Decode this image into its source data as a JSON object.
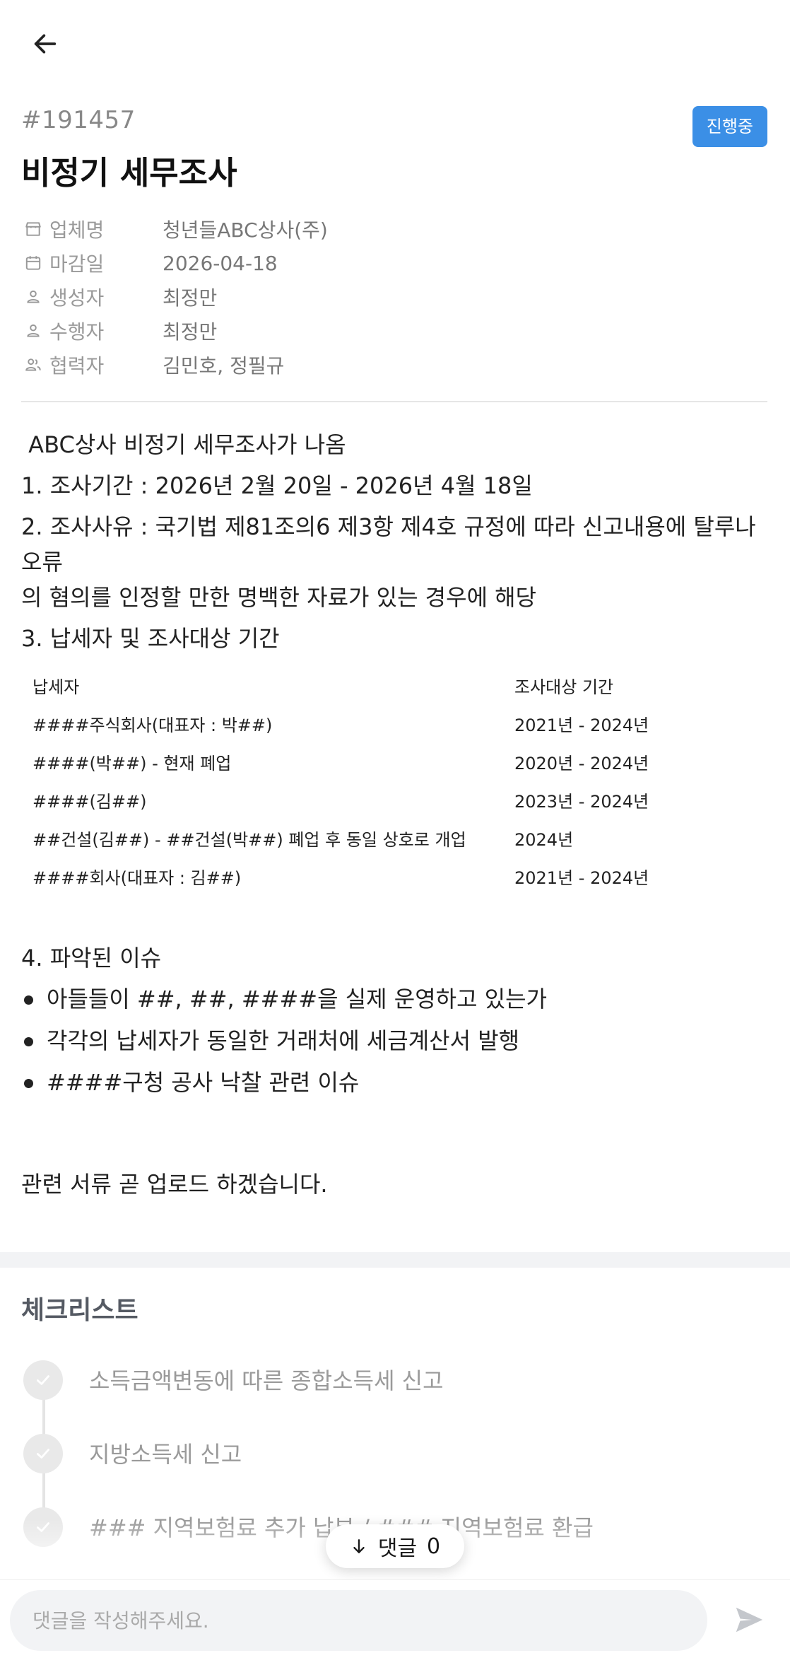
{
  "header": {
    "task_id": "#191457",
    "status": "진행중",
    "title": "비정기 세무조사"
  },
  "meta": [
    {
      "icon": "store-icon",
      "label": "업체명",
      "value": "청년들ABC상사(주)"
    },
    {
      "icon": "calendar-icon",
      "label": "마감일",
      "value": "2026-04-18"
    },
    {
      "icon": "person-icon",
      "label": "생성자",
      "value": "최정만"
    },
    {
      "icon": "person-icon",
      "label": "수행자",
      "value": "최정만"
    },
    {
      "icon": "people-icon",
      "label": "협력자",
      "value": "김민호, 정필규"
    }
  ],
  "body": {
    "intro": " ABC상사 비정기 세무조사가 나옴",
    "item1": "1. 조사기간 : 2026년 2월 20일 - 2026년 4월 18일",
    "item2_line1": "2. 조사사유 : 국기법 제81조의6 제3항 제4호 규정에 따라 신고내용에 탈루나 오류",
    "item2_line2": "의 혐의를 인정할 만한 명백한 자료가 있는 경우에 해당",
    "item3": "3. 납세자 및 조사대상 기간"
  },
  "table": {
    "headers": [
      "납세자",
      "조사대상 기간"
    ],
    "rows": [
      [
        "####주식회사(대표자 : 박##)",
        "2021년 - 2024년"
      ],
      [
        "####(박##) - 현재 폐업",
        "2020년 - 2024년"
      ],
      [
        "####(김##)",
        "2023년 - 2024년"
      ],
      [
        "##건설(김##) - ##건설(박##) 폐업 후 동일 상호로 개업",
        "2024년"
      ],
      [
        "####회사(대표자 : 김##)",
        "2021년 - 2024년"
      ]
    ]
  },
  "issues": {
    "heading": "4. 파악된 이슈",
    "bullets": [
      "아들들이 ##, ##, ####을 실제 운영하고 있는가",
      "각각의 납세자가 동일한 거래처에 세금계산서 발행",
      "####구청 공사 낙찰 관련 이슈"
    ]
  },
  "closing": "관련 서류 곧 업로드 하겠습니다.",
  "checklist": {
    "title": "체크리스트",
    "items": [
      "소득금액변동에 따른 종합소득세 신고",
      "지방소득세 신고",
      "### 지역보험료 추가 납부 / ### 지역보험료 환급"
    ]
  },
  "comments": {
    "label": "댓글",
    "count": "0",
    "placeholder": "댓글을 작성해주세요."
  }
}
